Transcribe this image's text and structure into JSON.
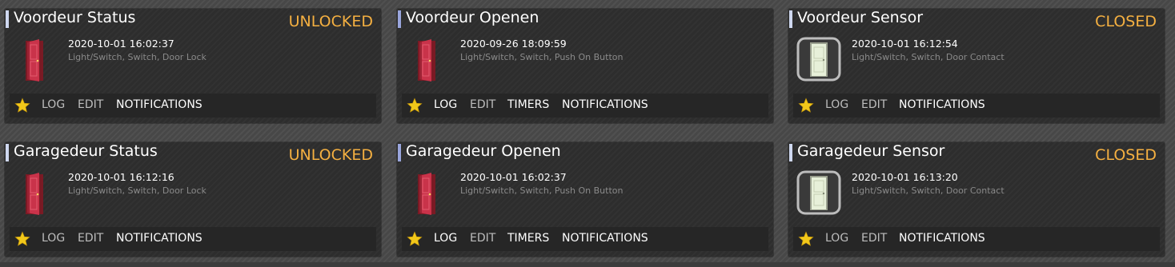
{
  "colors": {
    "accent_status": "#cfd8f0",
    "accent_switch": "#9aa6dd",
    "status_text": "#f5b041",
    "star": "#f2c81a"
  },
  "cards": [
    {
      "id": "voordeur-status",
      "title": "Voordeur Status",
      "status": "UNLOCKED",
      "datetime": "2020-10-01 16:02:37",
      "type": "Light/Switch, Switch, Door Lock",
      "icon": "red-door-icon",
      "actions": [
        "LOG",
        "EDIT",
        "NOTIFICATIONS"
      ]
    },
    {
      "id": "voordeur-openen",
      "title": "Voordeur Openen",
      "status": "",
      "datetime": "2020-09-26 18:09:59",
      "type": "Light/Switch, Switch, Push On Button",
      "icon": "red-door-icon",
      "actions": [
        "LOG",
        "EDIT",
        "TIMERS",
        "NOTIFICATIONS"
      ]
    },
    {
      "id": "voordeur-sensor",
      "title": "Voordeur Sensor",
      "status": "CLOSED",
      "datetime": "2020-10-01 16:12:54",
      "type": "Light/Switch, Switch, Door Contact",
      "icon": "closed-door-icon",
      "actions": [
        "LOG",
        "EDIT",
        "NOTIFICATIONS"
      ]
    },
    {
      "id": "garagedeur-status",
      "title": "Garagedeur Status",
      "status": "UNLOCKED",
      "datetime": "2020-10-01 16:12:16",
      "type": "Light/Switch, Switch, Door Lock",
      "icon": "red-door-icon",
      "actions": [
        "LOG",
        "EDIT",
        "NOTIFICATIONS"
      ]
    },
    {
      "id": "garagedeur-openen",
      "title": "Garagedeur Openen",
      "status": "",
      "datetime": "2020-10-01 16:02:37",
      "type": "Light/Switch, Switch, Push On Button",
      "icon": "red-door-icon",
      "actions": [
        "LOG",
        "EDIT",
        "TIMERS",
        "NOTIFICATIONS"
      ]
    },
    {
      "id": "garagedeur-sensor",
      "title": "Garagedeur Sensor",
      "status": "CLOSED",
      "datetime": "2020-10-01 16:13:20",
      "type": "Light/Switch, Switch, Door Contact",
      "icon": "closed-door-icon",
      "actions": [
        "LOG",
        "EDIT",
        "NOTIFICATIONS"
      ]
    }
  ]
}
